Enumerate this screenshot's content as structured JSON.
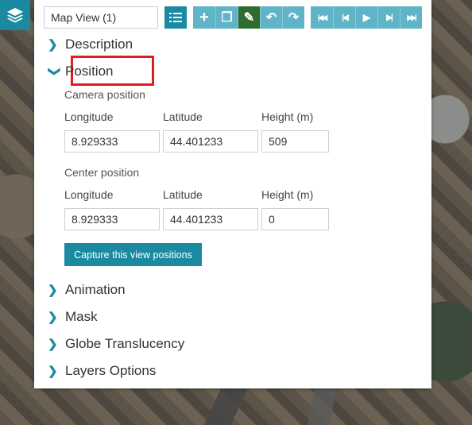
{
  "toolbar": {
    "title_value": "Map View (1)",
    "list_icon": "list-icon",
    "edit_buttons": [
      {
        "name": "add-icon",
        "glyph": "+"
      },
      {
        "name": "copy-icon",
        "glyph": "❐"
      },
      {
        "name": "pencil-icon",
        "glyph": "✎"
      },
      {
        "name": "undo-icon",
        "glyph": "↶"
      },
      {
        "name": "redo-icon",
        "glyph": "↷"
      }
    ],
    "nav_buttons": [
      {
        "name": "first-icon",
        "glyph": "|◀◀"
      },
      {
        "name": "previous-icon",
        "glyph": "|◀"
      },
      {
        "name": "play-icon",
        "glyph": "▶"
      },
      {
        "name": "next-icon",
        "glyph": "▶|"
      },
      {
        "name": "last-icon",
        "glyph": "▶▶|"
      }
    ]
  },
  "sections": {
    "description": "Description",
    "position": "Position",
    "animation": "Animation",
    "mask": "Mask",
    "globe_translucency": "Globe Translucency",
    "layers_options": "Layers Options"
  },
  "position": {
    "camera_title": "Camera position",
    "center_title": "Center position",
    "labels": {
      "longitude": "Longitude",
      "latitude": "Latitude",
      "height": "Height (m)"
    },
    "camera": {
      "longitude": "8.929333",
      "latitude": "44.401233",
      "height": "509"
    },
    "center": {
      "longitude": "8.929333",
      "latitude": "44.401233",
      "height": "0"
    },
    "capture_label": "Capture this view positions"
  },
  "colors": {
    "accent": "#1b8aa0",
    "highlight": "#e01b24",
    "active_tool": "#2e6b2f"
  }
}
